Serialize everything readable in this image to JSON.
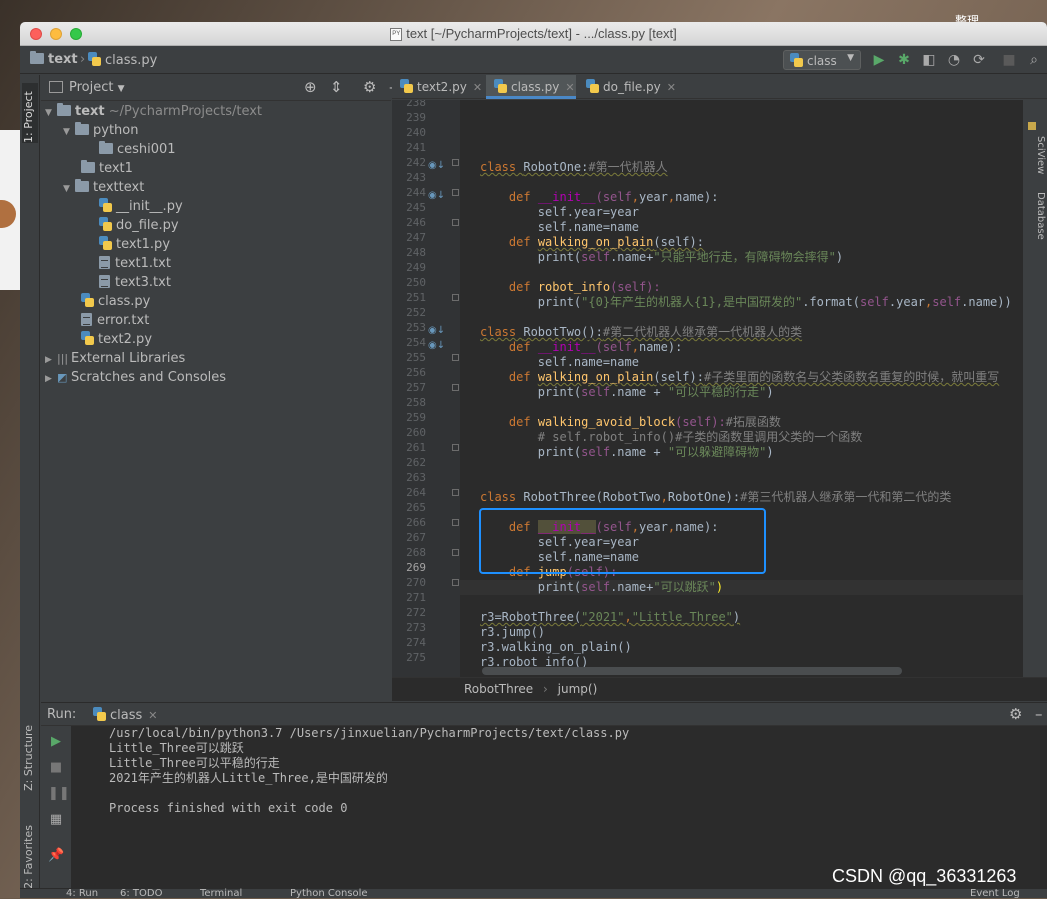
{
  "window": {
    "title": "text [~/PycharmProjects/text] - .../class.py [text]",
    "title_icon": "PY"
  },
  "desktop": {
    "corner_label": "整理"
  },
  "navbar": {
    "project": "text",
    "file": "class.py",
    "run_config": "class"
  },
  "tool_tabs": {
    "project": "1: Project",
    "structure": "Z: Structure",
    "favorites": "2: Favorites",
    "right_scview": "SciView",
    "right_database": "Database"
  },
  "project_panel": {
    "title": "Project",
    "root_name": "text",
    "root_path": "~/PycharmProjects/text",
    "items": [
      {
        "label": "python"
      },
      {
        "label": "ceshi001"
      },
      {
        "label": "text1"
      },
      {
        "label": "texttext"
      },
      {
        "label": "__init__.py"
      },
      {
        "label": "do_file.py"
      },
      {
        "label": "text1.py"
      },
      {
        "label": "text1.txt"
      },
      {
        "label": "text3.txt"
      },
      {
        "label": "class.py"
      },
      {
        "label": "error.txt"
      },
      {
        "label": "text2.py"
      },
      {
        "label": "External Libraries"
      },
      {
        "label": "Scratches and Consoles"
      }
    ]
  },
  "editor": {
    "tabs": [
      {
        "label": "text2.py"
      },
      {
        "label": "class.py"
      },
      {
        "label": "do_file.py"
      }
    ],
    "line_numbers": [
      "238",
      "239",
      "240",
      "241",
      "242",
      "243",
      "244",
      "245",
      "246",
      "247",
      "248",
      "249",
      "250",
      "251",
      "252",
      "253",
      "254",
      "255",
      "256",
      "257",
      "258",
      "259",
      "260",
      "261",
      "262",
      "263",
      "264",
      "265",
      "266",
      "267",
      "268",
      "269",
      "270",
      "271",
      "272",
      "273",
      "274",
      "275"
    ],
    "code": {
      "l241_def": "class ",
      "l241_name": "RobotOne",
      "l241_rest": ":",
      "l241_cm": "#第一代机器人",
      "l243_a": "def ",
      "l243_b": "__init__",
      "l243_c": "(self",
      "l243_d": ",",
      "l243_e": "year",
      "l243_f": ",",
      "l243_g": "name):",
      "l244": "self.year=year",
      "l245": "self.name=name",
      "l246_a": "def ",
      "l246_b": "walking_on_plain",
      "l246_c": "(self):",
      "l247_a": "print(",
      "l247_b": "self",
      "l247_c": ".name+",
      "l247_d": "\"只能平地行走，有障碍物会摔得\"",
      "l247_e": ")",
      "l249_a": "def ",
      "l249_b": "robot_info",
      "l249_c": "(self):",
      "l250_a": "print(",
      "l250_b": "\"{0}年产生的机器人{1},是中国研发的\"",
      "l250_c": ".format(",
      "l250_d": "self",
      "l250_e": ".year",
      "l250_f": ",",
      "l250_g": "self",
      "l250_h": ".name))",
      "l252_a": "class ",
      "l252_b": "RobotTwo():",
      "l252_cm": "#第二代机器人继承第一代机器人的类",
      "l253_a": "def ",
      "l253_b": "__init__",
      "l253_c": "(self",
      "l253_d": ",",
      "l253_e": "name):",
      "l254": "self.name=name",
      "l255_a": "def ",
      "l255_b": "walking_on_plain",
      "l255_c": "(self):",
      "l255_cm": "#子类里面的函数名与父类函数名重复的时候，就叫重写",
      "l256_a": "print(",
      "l256_b": "self",
      "l256_c": ".name + ",
      "l256_d": "\"可以平稳的行走\"",
      "l256_e": ")",
      "l258_a": "def ",
      "l258_b": "walking_avoid_block",
      "l258_c": "(self):",
      "l258_cm": "#拓展函数",
      "l259": "# self.robot_info()#子类的函数里调用父类的一个函数",
      "l260_a": "print(",
      "l260_b": "self",
      "l260_c": ".name + ",
      "l260_d": "\"可以躲避障碍物\"",
      "l260_e": ")",
      "l263_a": "class ",
      "l263_b": "RobotThree(RobotTwo",
      "l263_c": ",",
      "l263_d": "RobotOne):",
      "l263_cm": "#第三代机器人继承第一代和第二代的类",
      "l265_a": "def ",
      "l265_b": "__init__",
      "l265_c": "(self",
      "l265_d": ",",
      "l265_e": "year",
      "l265_f": ",",
      "l265_g": "name):",
      "l266": "self.year=year",
      "l267": "self.name=name",
      "l268_a": "def ",
      "l268_b": "jump",
      "l268_c": "(self):",
      "l269_a": "print(",
      "l269_b": "self",
      "l269_c": ".name+",
      "l269_d": "\"可以跳跃\"",
      "l269_e": ")",
      "l271_a": "r3=RobotThree(",
      "l271_b": "\"2021\"",
      "l271_c": ",",
      "l271_d": "\"Little_Three\"",
      "l271_e": ")",
      "l272": "r3.jump()",
      "l273": "r3.walking_on_plain()",
      "l274": "r3.robot_info()"
    },
    "breadcrumb": [
      "RobotThree",
      "jump()"
    ]
  },
  "run_panel": {
    "label": "Run:",
    "tab": "class",
    "output": [
      "/usr/local/bin/python3.7 /Users/jinxuelian/PycharmProjects/text/class.py",
      "Little_Three可以跳跃",
      "Little_Three可以平稳的行走",
      "2021年产生的机器人Little_Three,是中国研发的",
      "",
      "Process finished with exit code 0"
    ]
  },
  "watermark": "CSDN @qq_36331263",
  "status_bar": {
    "items": [
      "4: Run",
      "6: TODO",
      "Terminal",
      "Python Console",
      "Event Log"
    ]
  },
  "colors": {
    "editor_bg": "#2b2b2b",
    "keyword": "#cc7832",
    "function": "#ffc66d",
    "string": "#6a8759",
    "self": "#94558d",
    "highlight_box": "#1e90ff"
  }
}
